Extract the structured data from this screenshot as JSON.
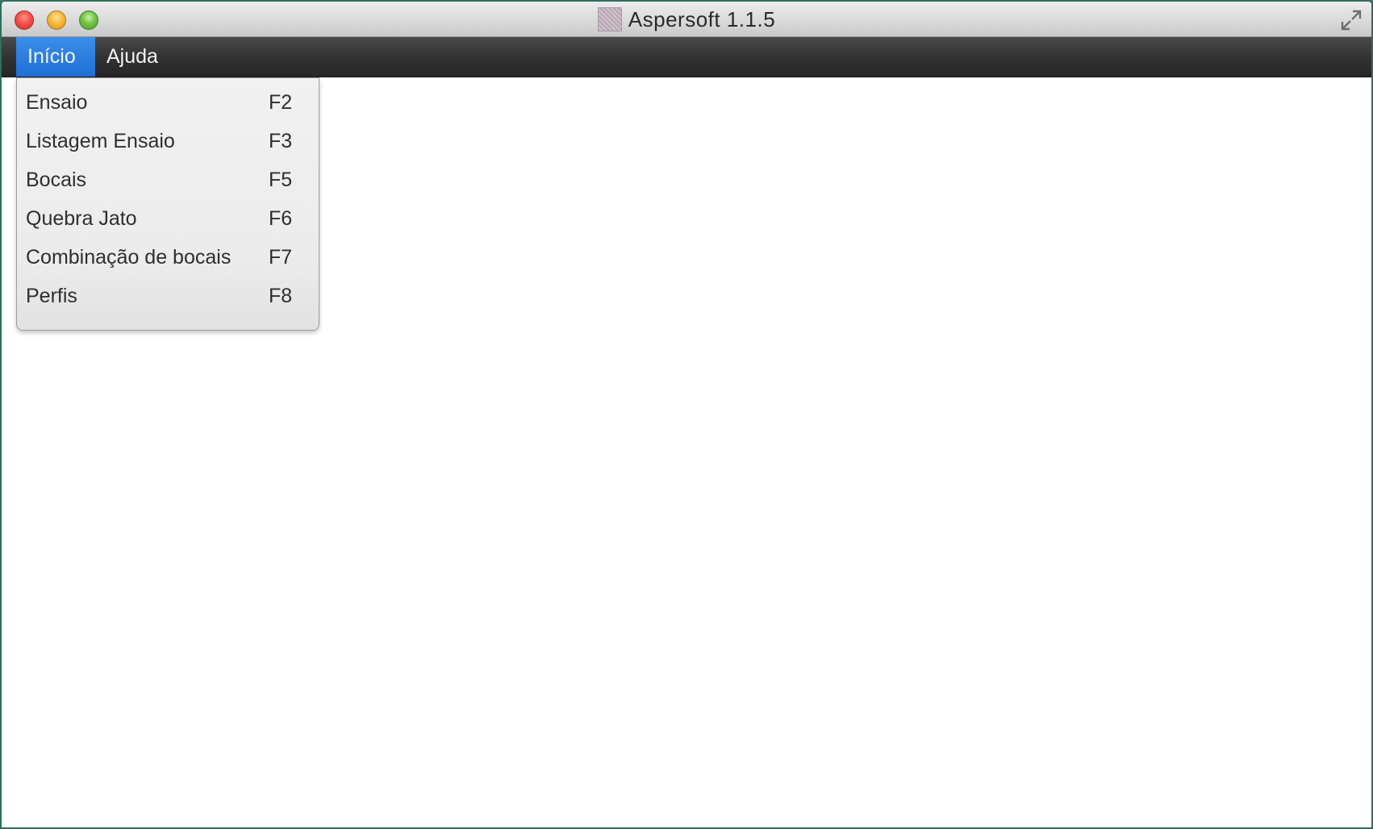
{
  "window": {
    "title": "Aspersoft 1.1.5"
  },
  "menubar": {
    "items": [
      {
        "label": "Início",
        "active": true
      },
      {
        "label": "Ajuda",
        "active": false
      }
    ]
  },
  "dropdown": {
    "items": [
      {
        "label": "Ensaio",
        "shortcut": "F2"
      },
      {
        "label": "Listagem Ensaio",
        "shortcut": "F3"
      },
      {
        "label": "Bocais",
        "shortcut": "F5"
      },
      {
        "label": "Quebra Jato",
        "shortcut": "F6"
      },
      {
        "label": "Combinação de bocais",
        "shortcut": "F7"
      },
      {
        "label": "Perfis",
        "shortcut": "F8"
      }
    ]
  },
  "icons": {
    "close": "close-icon",
    "minimize": "minimize-icon",
    "zoom": "zoom-icon",
    "app": "app-icon",
    "fullscreen": "fullscreen-icon"
  },
  "colors": {
    "menu_active": "#1f6fd6",
    "menubar_bg": "#333333",
    "dropdown_bg": "#eeeeee"
  }
}
